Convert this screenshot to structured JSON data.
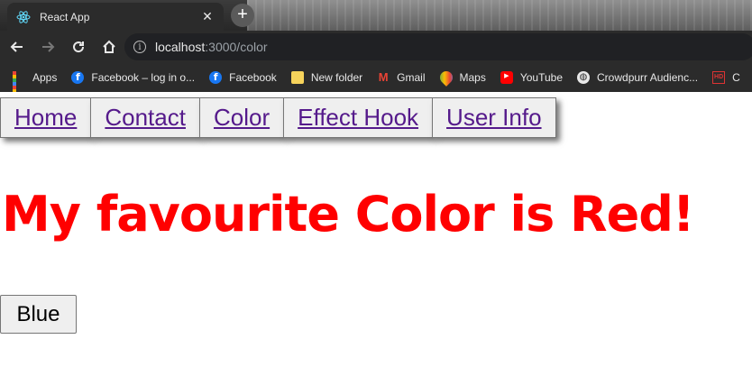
{
  "browser": {
    "tab_title": "React App",
    "url_host": "localhost",
    "url_path": ":3000/color",
    "bookmarks": [
      {
        "icon": "apps-icon",
        "label": "Apps"
      },
      {
        "icon": "facebook-icon",
        "label": "Facebook – log in o..."
      },
      {
        "icon": "facebook-icon",
        "label": "Facebook"
      },
      {
        "icon": "folder-icon",
        "label": "New folder"
      },
      {
        "icon": "gmail-icon",
        "label": "Gmail"
      },
      {
        "icon": "maps-icon",
        "label": "Maps"
      },
      {
        "icon": "youtube-icon",
        "label": "YouTube"
      },
      {
        "icon": "globe-icon",
        "label": "Crowdpurr Audienc..."
      },
      {
        "icon": "hd-icon",
        "label": "C"
      }
    ]
  },
  "nav": {
    "links": [
      {
        "label": "Home"
      },
      {
        "label": "Contact"
      },
      {
        "label": "Color"
      },
      {
        "label": "Effect Hook"
      },
      {
        "label": "User Info"
      }
    ]
  },
  "main": {
    "headline": "My favourite Color is Red!",
    "button_label": "Blue"
  },
  "colors": {
    "headline": "#ff0000",
    "link": "#551a8b"
  }
}
